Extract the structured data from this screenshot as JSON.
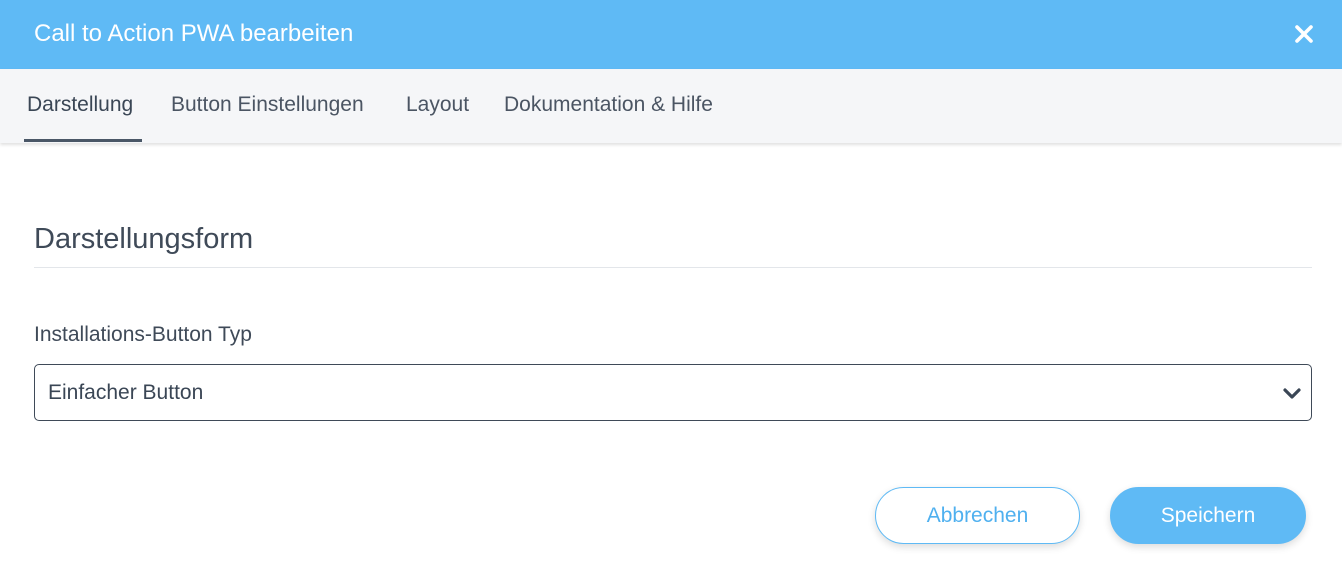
{
  "dialog": {
    "title": "Call to Action PWA bearbeiten",
    "close_icon": "close-icon"
  },
  "tabs": [
    {
      "label": "Darstellung",
      "active": true
    },
    {
      "label": "Button Einstellungen",
      "active": false
    },
    {
      "label": "Layout",
      "active": false
    },
    {
      "label": "Dokumentation & Hilfe",
      "active": false
    }
  ],
  "section": {
    "title": "Darstellungsform"
  },
  "field": {
    "label": "Installations-Button Typ",
    "selected_value": "Einfacher Button",
    "icon": "chevron-down-icon"
  },
  "actions": {
    "cancel_label": "Abbrechen",
    "save_label": "Speichern"
  },
  "colors": {
    "header": "#5fbaf5",
    "accent": "#5fbaf5",
    "text": "#3f4a58",
    "tab_bar": "#f5f6f8"
  }
}
